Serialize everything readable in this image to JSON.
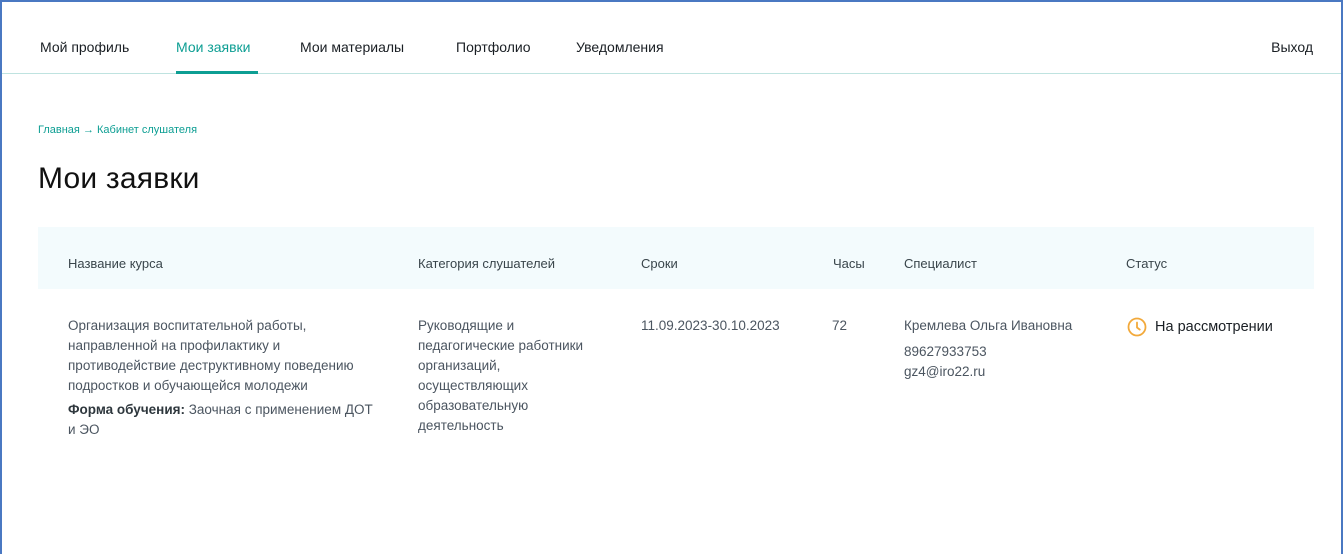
{
  "nav": {
    "items": [
      {
        "label": "Мой профиль"
      },
      {
        "label": "Мои заявки"
      },
      {
        "label": "Мои материалы"
      },
      {
        "label": "Портфолио"
      },
      {
        "label": "Уведомления"
      }
    ],
    "active_index": 1,
    "logout_label": "Выход"
  },
  "breadcrumb": {
    "home": "Главная",
    "separator": "→",
    "current": "Кабинет слушателя"
  },
  "page_title": "Мои заявки",
  "table": {
    "headers": {
      "course": "Название курса",
      "category": "Категория слушателей",
      "dates": "Сроки",
      "hours": "Часы",
      "specialist": "Специалист",
      "status": "Статус"
    },
    "rows": [
      {
        "course_name": "Организация воспитательной работы, направленной на профилактику и противодействие деструктивному поведению подростков и обучающейся молодежи",
        "form_label": "Форма обучения:",
        "form_value": "Заочная с применением ДОТ и ЭО",
        "category": "Руководящие и педагогические работники организаций, осуществляющих образовательную деятельность",
        "dates": "11.09.2023-30.10.2023",
        "hours": "72",
        "specialist_name": "Кремлева Ольга Ивановна",
        "specialist_phone": "89627933753",
        "specialist_email": "gz4@iro22.ru",
        "status": "На рассмотрении",
        "status_icon": "clock-icon"
      }
    ]
  },
  "colors": {
    "accent": "#0d9e93",
    "header_bg": "#f3fbfd",
    "status_icon": "#f2a93b",
    "frame_border": "#4a78c2"
  }
}
